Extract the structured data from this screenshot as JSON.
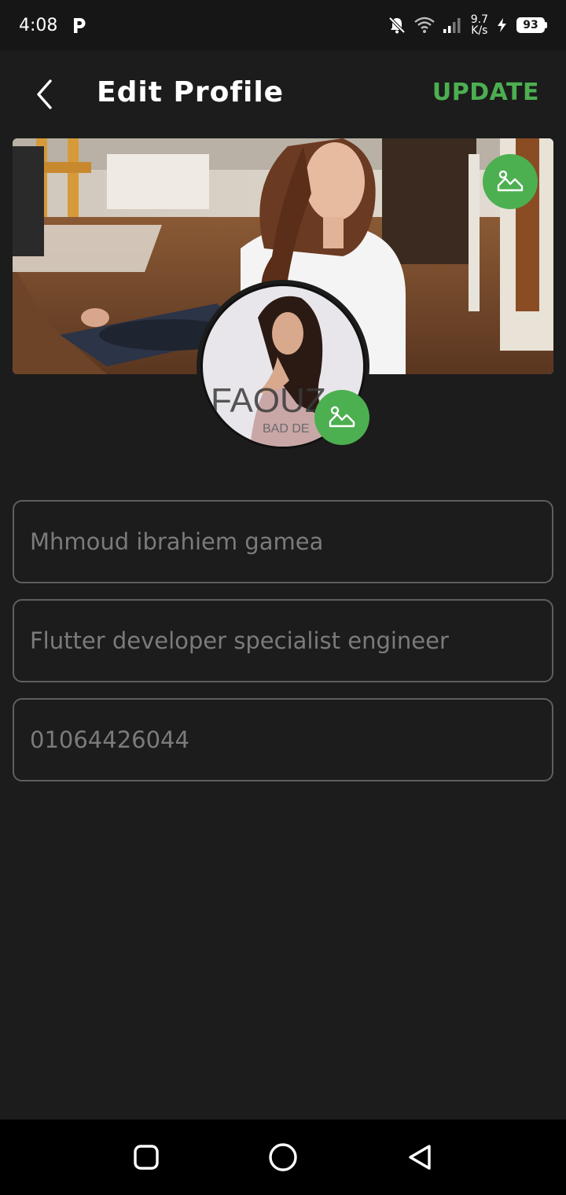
{
  "status_bar": {
    "time": "4:08",
    "speed_value": "9.7",
    "speed_unit": "K/s",
    "battery": "93"
  },
  "header": {
    "title": "Edit Profile",
    "update_label": "UPDATE"
  },
  "avatar": {
    "brand_text": "FAOUZ",
    "brand_subtext": "BAD DE"
  },
  "form": {
    "name_value": "Mhmoud ibrahiem gamea",
    "bio_value": "Flutter developer specialist engineer",
    "phone_value": "01064426044"
  },
  "colors": {
    "accent": "#4caf50",
    "background": "#1c1c1c"
  },
  "icons": {
    "back": "chevron-left-icon",
    "edit_image": "image-icon",
    "nav_recent": "square-icon",
    "nav_home": "circle-icon",
    "nav_back": "triangle-back-icon"
  }
}
